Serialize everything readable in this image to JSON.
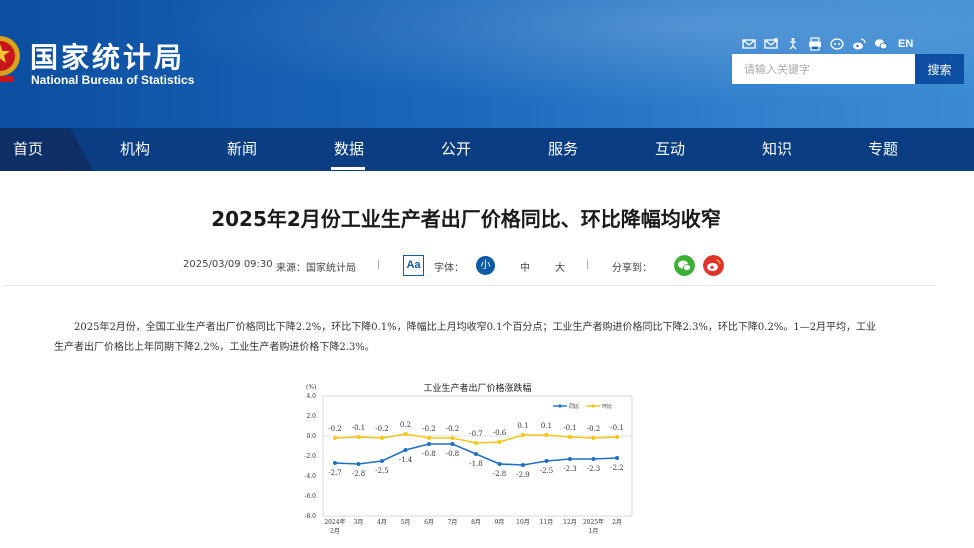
{
  "header": {
    "logo_cn": "国家统计局",
    "logo_en": "National Bureau of Statistics",
    "lang_switch": "EN",
    "tool_icons": [
      "mail-icon",
      "message-icon",
      "accessibility-icon",
      "print-icon",
      "app-icon",
      "weibo-icon",
      "wechat-icon"
    ]
  },
  "search": {
    "placeholder": "请输入关键字",
    "button_label": "搜索"
  },
  "nav": {
    "items": [
      "首页",
      "机构",
      "新闻",
      "数据",
      "公开",
      "服务",
      "互动",
      "知识",
      "专题"
    ],
    "active": "数据"
  },
  "article": {
    "title": "2025年2月份工业生产者出厂价格同比、环比降幅均收窄",
    "date": "2025/03/09 09:30",
    "source": "来源：国家统计局",
    "font_label": "字体：",
    "font_icon_label": "Aa",
    "font_small": "小",
    "font_medium": "中",
    "font_large": "大",
    "share_label": "分享到：",
    "separator": "|",
    "paragraph": "2025年2月份，全国工业生产者出厂价格同比下降2.2%，环比下降0.1%，降幅比上月均收窄0.1个百分点；工业生产者购进价格同比下降2.3%，环比下降0.2%。1—2月平均，工业生产者出厂价格比上年同期下降2.2%，工业生产者购进价格下降2.3%。"
  },
  "colors": {
    "header_blue": "#1a67bb",
    "nav_blue": "#0a3d82",
    "yoy_series": "#1f6fc6",
    "mom_series": "#f5c518",
    "wechat_green": "#3cb034",
    "weibo_red": "#e0332b"
  },
  "chart_data": {
    "type": "line",
    "title": "工业生产者出厂价格涨跌幅",
    "ylabel": "(%)",
    "ylim": [
      -8.0,
      4.0
    ],
    "yticks": [
      "4.0",
      "2.0",
      "0.0",
      "-2.0",
      "-4.0",
      "-6.0",
      "-8.0"
    ],
    "categories": [
      "2024年\n2月",
      "3月",
      "4月",
      "5月",
      "6月",
      "7月",
      "8月",
      "9月",
      "10月",
      "11月",
      "12月",
      "2025年\n1月",
      "2月"
    ],
    "legend_position": "top-right",
    "series": [
      {
        "name": "同比",
        "color": "#1f6fc6",
        "values": [
          -2.7,
          -2.8,
          -2.5,
          -1.4,
          -0.8,
          -0.8,
          -1.8,
          -2.8,
          -2.9,
          -2.5,
          -2.3,
          -2.3,
          -2.2
        ]
      },
      {
        "name": "环比",
        "color": "#f5c518",
        "values": [
          -0.2,
          -0.1,
          -0.2,
          0.2,
          -0.2,
          -0.2,
          -0.7,
          -0.6,
          0.1,
          0.1,
          -0.1,
          -0.2,
          -0.1
        ]
      }
    ]
  }
}
